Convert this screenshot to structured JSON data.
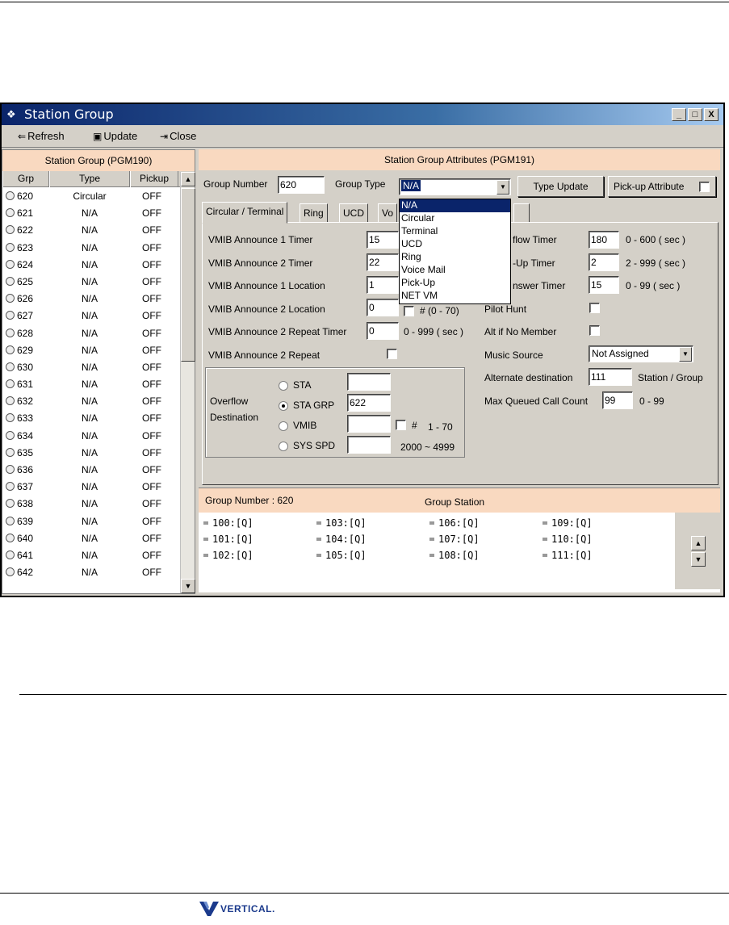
{
  "window": {
    "title": "Station Group",
    "controls": [
      "_",
      "□",
      "X"
    ]
  },
  "toolbar": {
    "refresh": "Refresh",
    "update": "Update",
    "close": "Close"
  },
  "left_panel": {
    "header": "Station Group (PGM190)",
    "columns": [
      "Grp",
      "Type",
      "Pickup"
    ],
    "rows": [
      {
        "grp": "620",
        "type": "Circular",
        "pickup": "OFF"
      },
      {
        "grp": "621",
        "type": "N/A",
        "pickup": "OFF"
      },
      {
        "grp": "622",
        "type": "N/A",
        "pickup": "OFF"
      },
      {
        "grp": "623",
        "type": "N/A",
        "pickup": "OFF"
      },
      {
        "grp": "624",
        "type": "N/A",
        "pickup": "OFF"
      },
      {
        "grp": "625",
        "type": "N/A",
        "pickup": "OFF"
      },
      {
        "grp": "626",
        "type": "N/A",
        "pickup": "OFF"
      },
      {
        "grp": "627",
        "type": "N/A",
        "pickup": "OFF"
      },
      {
        "grp": "628",
        "type": "N/A",
        "pickup": "OFF"
      },
      {
        "grp": "629",
        "type": "N/A",
        "pickup": "OFF"
      },
      {
        "grp": "630",
        "type": "N/A",
        "pickup": "OFF"
      },
      {
        "grp": "631",
        "type": "N/A",
        "pickup": "OFF"
      },
      {
        "grp": "632",
        "type": "N/A",
        "pickup": "OFF"
      },
      {
        "grp": "633",
        "type": "N/A",
        "pickup": "OFF"
      },
      {
        "grp": "634",
        "type": "N/A",
        "pickup": "OFF"
      },
      {
        "grp": "635",
        "type": "N/A",
        "pickup": "OFF"
      },
      {
        "grp": "636",
        "type": "N/A",
        "pickup": "OFF"
      },
      {
        "grp": "637",
        "type": "N/A",
        "pickup": "OFF"
      },
      {
        "grp": "638",
        "type": "N/A",
        "pickup": "OFF"
      },
      {
        "grp": "639",
        "type": "N/A",
        "pickup": "OFF"
      },
      {
        "grp": "640",
        "type": "N/A",
        "pickup": "OFF"
      },
      {
        "grp": "641",
        "type": "N/A",
        "pickup": "OFF"
      },
      {
        "grp": "642",
        "type": "N/A",
        "pickup": "OFF"
      }
    ]
  },
  "right_panel": {
    "header": "Station Group Attributes (PGM191)",
    "group_number_label": "Group Number",
    "group_number_value": "620",
    "group_type_label": "Group Type",
    "group_type_value": "N/A",
    "type_update": "Type Update",
    "pickup_attribute": "Pick-up Attribute",
    "group_type_options": [
      "N/A",
      "Circular",
      "Terminal",
      "UCD",
      "Ring",
      "Voice Mail",
      "Pick-Up",
      "NET VM"
    ],
    "tabs": [
      "Circular / Terminal",
      "Ring",
      "UCD",
      "Vo"
    ],
    "fields": {
      "vmib_ann1_timer": {
        "label": "VMIB Announce 1 Timer",
        "value": "15"
      },
      "vmib_ann2_timer": {
        "label": "VMIB Announce 2 Timer",
        "value": "22"
      },
      "vmib_ann1_loc": {
        "label": "VMIB Announce 1 Location",
        "value": "1"
      },
      "vmib_ann2_loc": {
        "label": "VMIB Announce 2 Location",
        "value": "0",
        "hint": "# (0 - 70)"
      },
      "vmib_ann2_repeat_timer": {
        "label": "VMIB Announce 2 Repeat Timer",
        "value": "0",
        "range": "0 - 999 ( sec )"
      },
      "vmib_ann2_repeat": {
        "label": "VMIB Announce 2 Repeat"
      }
    },
    "overflow": {
      "label_line1": "Overflow",
      "label_line2": "Destination",
      "sta": {
        "label": "STA",
        "value": ""
      },
      "sta_grp": {
        "label": "STA GRP",
        "value": "622"
      },
      "vmib": {
        "label": "VMIB",
        "value": "",
        "hint": "#",
        "range": "1 - 70"
      },
      "sys_spd": {
        "label": "SYS SPD",
        "value": "",
        "range": "2000 ~ 4999"
      }
    },
    "right_fields": {
      "overflow_timer": {
        "label": "flow Timer",
        "value": "180",
        "range": "0 - 600 ( sec )"
      },
      "pickup_timer": {
        "label": "-Up Timer",
        "value": "2",
        "range": "2 - 999 ( sec )"
      },
      "no_answer_timer": {
        "label": "nswer Timer",
        "value": "15",
        "range": "0 - 99 ( sec )"
      },
      "pilot_hunt": {
        "label": "Pilot Hunt"
      },
      "alt_no_member": {
        "label": "Alt if No Member"
      },
      "music_source": {
        "label": "Music Source",
        "value": "Not Assigned"
      },
      "alt_destination": {
        "label": "Alternate destination",
        "value": "111",
        "suffix": "Station / Group"
      },
      "max_queued": {
        "label": "Max Queued Call Count",
        "value": "99",
        "range": "0 - 99"
      }
    }
  },
  "bottom_panel": {
    "group_number_label": "Group Number : 620",
    "group_station_label": "Group Station",
    "stations": [
      "100:[Q]",
      "101:[Q]",
      "102:[Q]",
      "103:[Q]",
      "104:[Q]",
      "105:[Q]",
      "106:[Q]",
      "107:[Q]",
      "108:[Q]",
      "109:[Q]",
      "110:[Q]",
      "111:[Q]"
    ]
  },
  "footer": {
    "logo_text": "VERTICAL."
  }
}
